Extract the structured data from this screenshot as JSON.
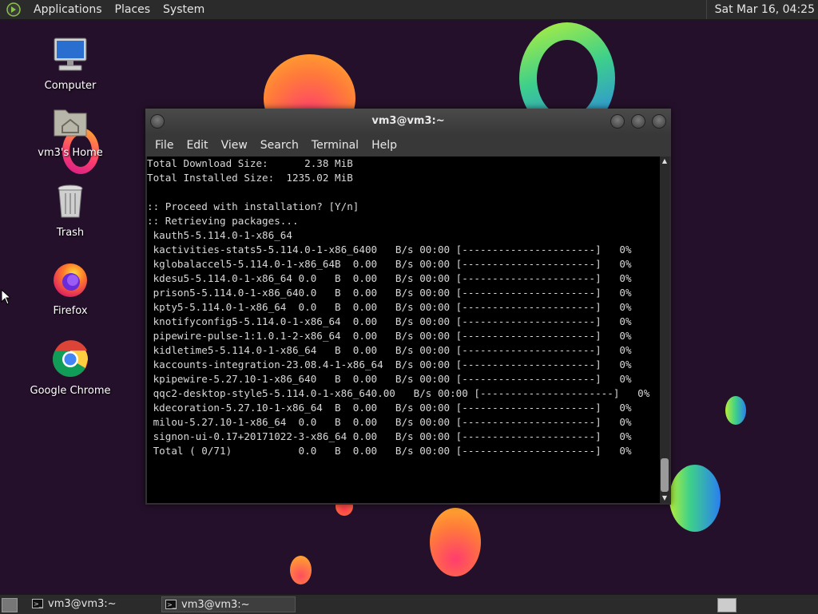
{
  "top_panel": {
    "menus": [
      "Applications",
      "Places",
      "System"
    ],
    "clock": "Sat Mar 16, 04:25"
  },
  "desktop_icons": [
    {
      "label": "Computer",
      "icon": "computer-icon"
    },
    {
      "label": "vm3's Home",
      "icon": "home-folder-icon"
    },
    {
      "label": "Trash",
      "icon": "trash-icon"
    },
    {
      "label": "Firefox",
      "icon": "firefox-icon"
    },
    {
      "label": "Google Chrome",
      "icon": "chrome-icon"
    }
  ],
  "window": {
    "title": "vm3@vm3:~",
    "menu": [
      "File",
      "Edit",
      "View",
      "Search",
      "Terminal",
      "Help"
    ]
  },
  "terminal": {
    "lines": [
      "Total Download Size:      2.38 MiB",
      "Total Installed Size:  1235.02 MiB",
      "",
      ":: Proceed with installation? [Y/n]",
      ":: Retrieving packages...",
      " kauth5-5.114.0-1-x86_64",
      " kactivities-stats5-5.114.0-1-x86_6400   B/s 00:00 [----------------------]   0%",
      " kglobalaccel5-5.114.0-1-x86_64B  0.00   B/s 00:00 [----------------------]   0%",
      " kdesu5-5.114.0-1-x86_64 0.0   B  0.00   B/s 00:00 [----------------------]   0%",
      " prison5-5.114.0-1-x86_640.0   B  0.00   B/s 00:00 [----------------------]   0%",
      " kpty5-5.114.0-1-x86_64  0.0   B  0.00   B/s 00:00 [----------------------]   0%",
      " knotifyconfig5-5.114.0-1-x86_64  0.00   B/s 00:00 [----------------------]   0%",
      " pipewire-pulse-1:1.0.1-2-x86_64  0.00   B/s 00:00 [----------------------]   0%",
      " kidletime5-5.114.0-1-x86_64   B  0.00   B/s 00:00 [----------------------]   0%",
      " kaccounts-integration-23.08.4-1-x86_64  B/s 00:00 [----------------------]   0%",
      " kpipewire-5.27.10-1-x86_640   B  0.00   B/s 00:00 [----------------------]   0%",
      " qqc2-desktop-style5-5.114.0-1-x86_640.00   B/s 00:00 [----------------------]   0%",
      " kdecoration-5.27.10-1-x86_64  B  0.00   B/s 00:00 [----------------------]   0%",
      " milou-5.27.10-1-x86_64  0.0   B  0.00   B/s 00:00 [----------------------]   0%",
      " signon-ui-0.17+20171022-3-x86_64 0.00   B/s 00:00 [----------------------]   0%",
      " Total ( 0/71)           0.0   B  0.00   B/s 00:00 [----------------------]   0%"
    ]
  },
  "taskbar": {
    "tasks": [
      {
        "label": "vm3@vm3:~",
        "active": false
      },
      {
        "label": "vm3@vm3:~",
        "active": true
      }
    ]
  }
}
